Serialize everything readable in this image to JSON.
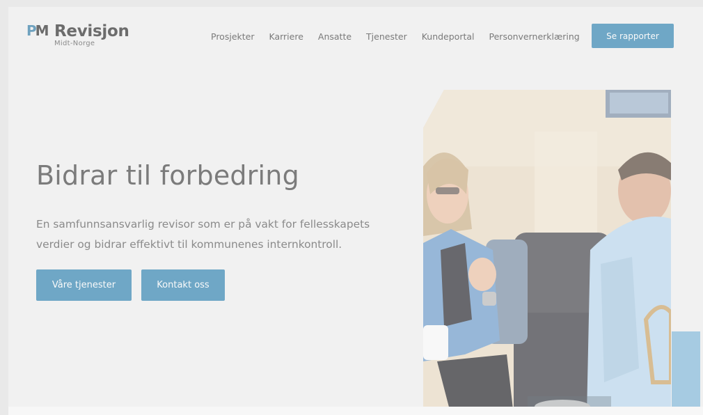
{
  "header": {
    "logo": {
      "mark": "PM",
      "name": "Revisjon",
      "sub": "Midt-Norge"
    },
    "nav": [
      "Prosjekter",
      "Karriere",
      "Ansatte",
      "Tjenester",
      "Kundeportal",
      "Personvernerklæring"
    ],
    "cta": "Se rapporter"
  },
  "hero": {
    "title": "Bidrar til forbedring",
    "text": "En samfunnsansvarlig revisor som er på vakt for fellesskapets verdier og bidrar effektivt til kommunenes internkontroll.",
    "buttons": {
      "services": "Våre tjenester",
      "contact": "Kontakt oss"
    }
  },
  "colors": {
    "accent": "#6fa7c6",
    "accent_light": "#a6cbe2",
    "text": "#7b7b7b",
    "background": "#f1f1f1"
  },
  "photo": {
    "subject": "two people talking in an office lounge"
  }
}
